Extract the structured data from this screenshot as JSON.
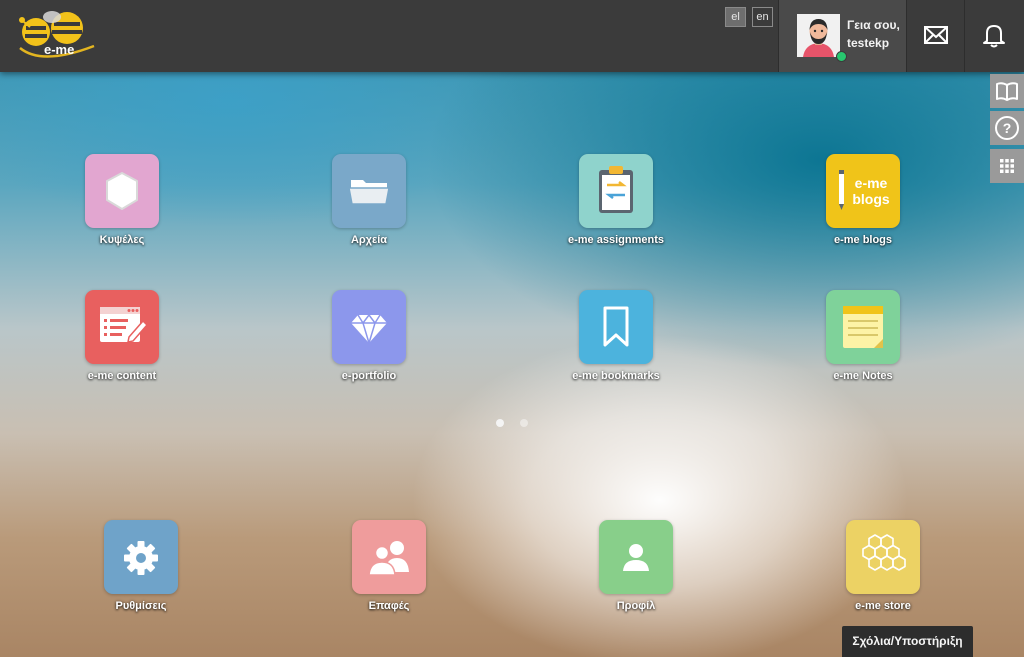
{
  "header": {
    "logo_text": "e-me",
    "languages": [
      {
        "code": "el",
        "active": true
      },
      {
        "code": "en",
        "active": false
      }
    ],
    "user": {
      "greeting": "Γεια σου,",
      "username": "testekp",
      "status": "online"
    },
    "mail_icon": "envelope-icon",
    "notifications_icon": "bell-icon"
  },
  "side_buttons": [
    {
      "name": "book-icon"
    },
    {
      "name": "help-icon"
    },
    {
      "name": "apps-grid-icon"
    }
  ],
  "apps": [
    {
      "label": "Κυψέλες",
      "icon": "hexagon-icon",
      "color": "#e2a6d0"
    },
    {
      "label": "Αρχεία",
      "icon": "folder-icon",
      "color": "#7aa8c9"
    },
    {
      "label": "e-me assignments",
      "icon": "clipboard-icon",
      "color": "#8fd3cc"
    },
    {
      "label": "e-me blogs",
      "icon": "blogs-icon",
      "color": "#f0c419"
    },
    {
      "label": "e-me content",
      "icon": "content-editor-icon",
      "color": "#e8605f"
    },
    {
      "label": "e-portfolio",
      "icon": "diamond-icon",
      "color": "#8c97ec"
    },
    {
      "label": "e-me bookmarks",
      "icon": "bookmark-icon",
      "color": "#4cb3dd"
    },
    {
      "label": "e-me Notes",
      "icon": "notepad-icon",
      "color": "#7fd29a"
    }
  ],
  "dock": [
    {
      "label": "Ρυθμίσεις",
      "icon": "gear-icon",
      "color": "#6fa3c9"
    },
    {
      "label": "Επαφές",
      "icon": "contacts-icon",
      "color": "#ef9c9c"
    },
    {
      "label": "Προφίλ",
      "icon": "profile-icon",
      "color": "#88cf8a"
    },
    {
      "label": "e-me store",
      "icon": "honeycomb-icon",
      "color": "#ecd264"
    }
  ],
  "pagination": {
    "pages": 2,
    "current": 1
  },
  "feedback_label": "Σχόλια/Υποστήριξη"
}
